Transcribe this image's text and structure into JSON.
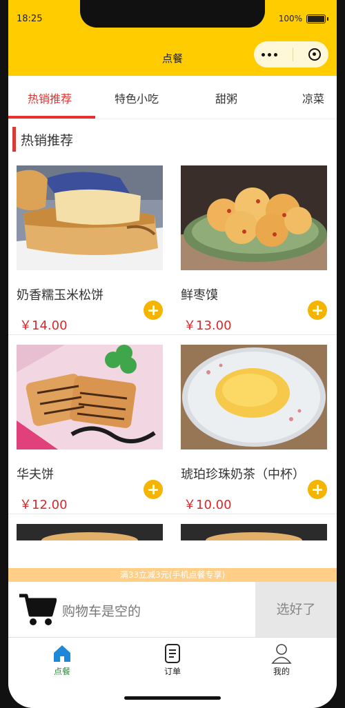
{
  "status_bar": {
    "time": "18:25",
    "battery": "100%"
  },
  "navbar": {
    "title": "点餐"
  },
  "category_tabs": [
    {
      "label": "热销推荐",
      "active": true
    },
    {
      "label": "特色小吃",
      "active": false
    },
    {
      "label": "甜粥",
      "active": false
    },
    {
      "label": "凉菜",
      "active": false
    }
  ],
  "section": {
    "title": "热销推荐"
  },
  "products": [
    {
      "name": "奶香糯玉米松饼",
      "price": "￥14.00"
    },
    {
      "name": "鲜枣馍",
      "price": "￥13.00"
    },
    {
      "name": "华夫饼",
      "price": "￥12.00"
    },
    {
      "name": "琥珀珍珠奶茶（中杯）",
      "price": "￥10.00"
    }
  ],
  "promo": {
    "text": "满33立减3元(手机点餐专享)"
  },
  "cart": {
    "empty_text": "购物车是空的",
    "checkout_label": "选好了"
  },
  "tabbar": [
    {
      "label": "点餐",
      "icon": "home-icon",
      "active": true
    },
    {
      "label": "订单",
      "icon": "order-icon",
      "active": false
    },
    {
      "label": "我的",
      "icon": "user-icon",
      "active": false
    }
  ],
  "colors": {
    "brand_yellow": "#ffcc00",
    "accent_red": "#e8302d",
    "add_button": "#f5b400",
    "active_tab_green": "#2c8a3e"
  }
}
